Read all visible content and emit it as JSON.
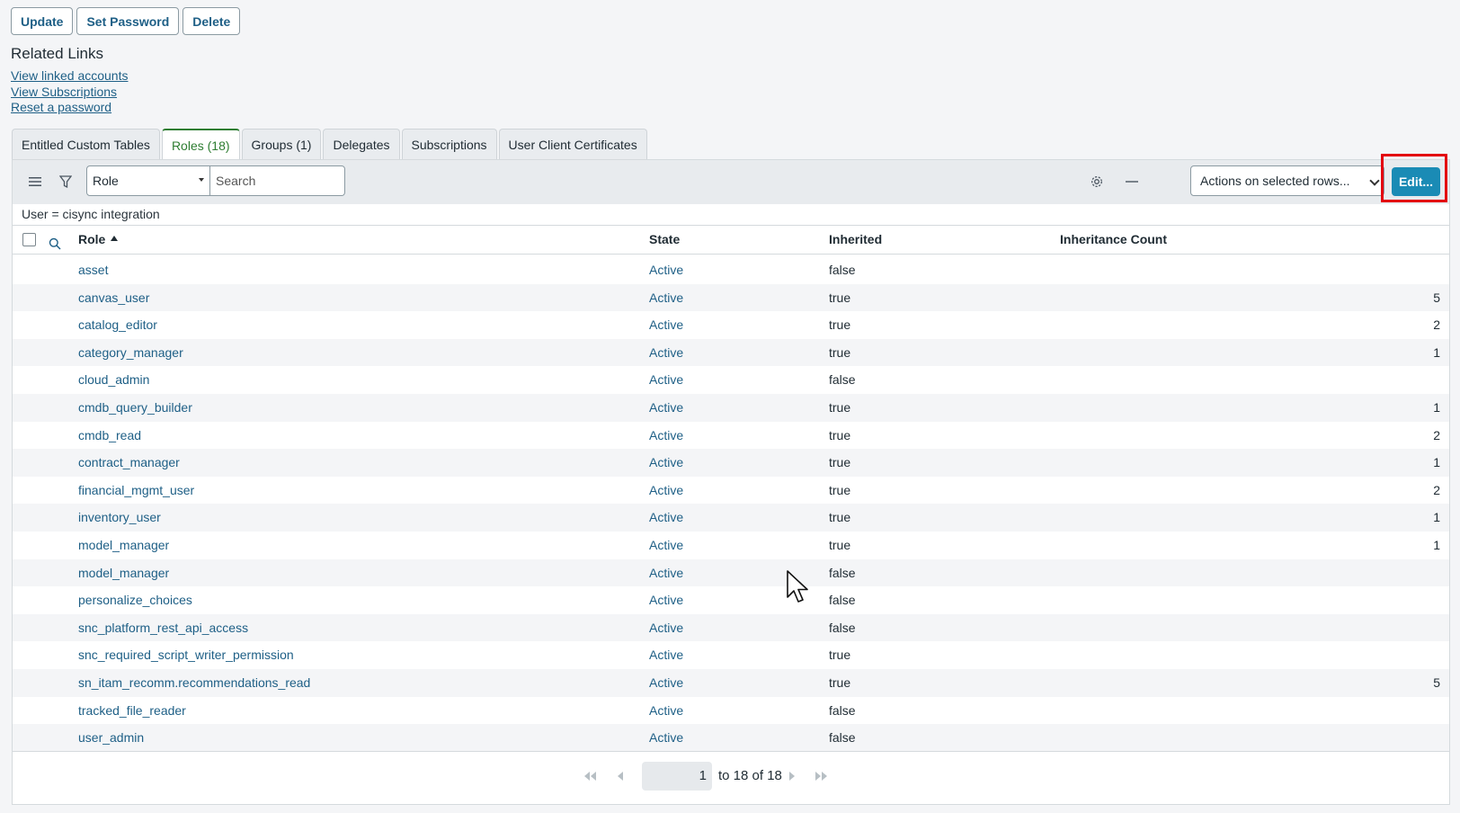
{
  "form_buttons": {
    "update": "Update",
    "set_password": "Set Password",
    "delete": "Delete"
  },
  "related": {
    "title": "Related Links",
    "links": [
      "View linked accounts",
      "View Subscriptions",
      "Reset a password"
    ]
  },
  "tabs": [
    {
      "label": "Entitled Custom Tables",
      "active": false
    },
    {
      "label": "Roles (18)",
      "active": true
    },
    {
      "label": "Groups (1)",
      "active": false
    },
    {
      "label": "Delegates",
      "active": false
    },
    {
      "label": "Subscriptions",
      "active": false
    },
    {
      "label": "User Client Certificates",
      "active": false
    }
  ],
  "toolbar": {
    "menu_icon": "hamburger-icon",
    "filter_icon": "funnel-icon",
    "search_field_select": "Role",
    "search_placeholder": "Search",
    "settings_icon": "gear-icon",
    "collapse_icon": "minus-icon",
    "actions_select": "Actions on selected rows...",
    "edit_label": "Edit..."
  },
  "filter": "User = cisync integration",
  "table": {
    "columns": [
      "Role",
      "State",
      "Inherited",
      "Inheritance Count"
    ],
    "rows": [
      {
        "role": "asset",
        "state": "Active",
        "inherited": "false",
        "count": ""
      },
      {
        "role": "canvas_user",
        "state": "Active",
        "inherited": "true",
        "count": "5"
      },
      {
        "role": "catalog_editor",
        "state": "Active",
        "inherited": "true",
        "count": "2"
      },
      {
        "role": "category_manager",
        "state": "Active",
        "inherited": "true",
        "count": "1"
      },
      {
        "role": "cloud_admin",
        "state": "Active",
        "inherited": "false",
        "count": ""
      },
      {
        "role": "cmdb_query_builder",
        "state": "Active",
        "inherited": "true",
        "count": "1"
      },
      {
        "role": "cmdb_read",
        "state": "Active",
        "inherited": "true",
        "count": "2"
      },
      {
        "role": "contract_manager",
        "state": "Active",
        "inherited": "true",
        "count": "1"
      },
      {
        "role": "financial_mgmt_user",
        "state": "Active",
        "inherited": "true",
        "count": "2"
      },
      {
        "role": "inventory_user",
        "state": "Active",
        "inherited": "true",
        "count": "1"
      },
      {
        "role": "model_manager",
        "state": "Active",
        "inherited": "true",
        "count": "1"
      },
      {
        "role": "model_manager",
        "state": "Active",
        "inherited": "false",
        "count": ""
      },
      {
        "role": "personalize_choices",
        "state": "Active",
        "inherited": "false",
        "count": ""
      },
      {
        "role": "snc_platform_rest_api_access",
        "state": "Active",
        "inherited": "false",
        "count": ""
      },
      {
        "role": "snc_required_script_writer_permission",
        "state": "Active",
        "inherited": "true",
        "count": ""
      },
      {
        "role": "sn_itam_recomm.recommendations_read",
        "state": "Active",
        "inherited": "true",
        "count": "5"
      },
      {
        "role": "tracked_file_reader",
        "state": "Active",
        "inherited": "false",
        "count": ""
      },
      {
        "role": "user_admin",
        "state": "Active",
        "inherited": "false",
        "count": ""
      }
    ]
  },
  "pagination": {
    "current": "1",
    "range_text": "to 18 of 18"
  },
  "colors": {
    "link": "#1e5f86",
    "active_tab": "#2e7d32",
    "edit_button": "#1a8bb5",
    "highlight": "#e3000f"
  }
}
